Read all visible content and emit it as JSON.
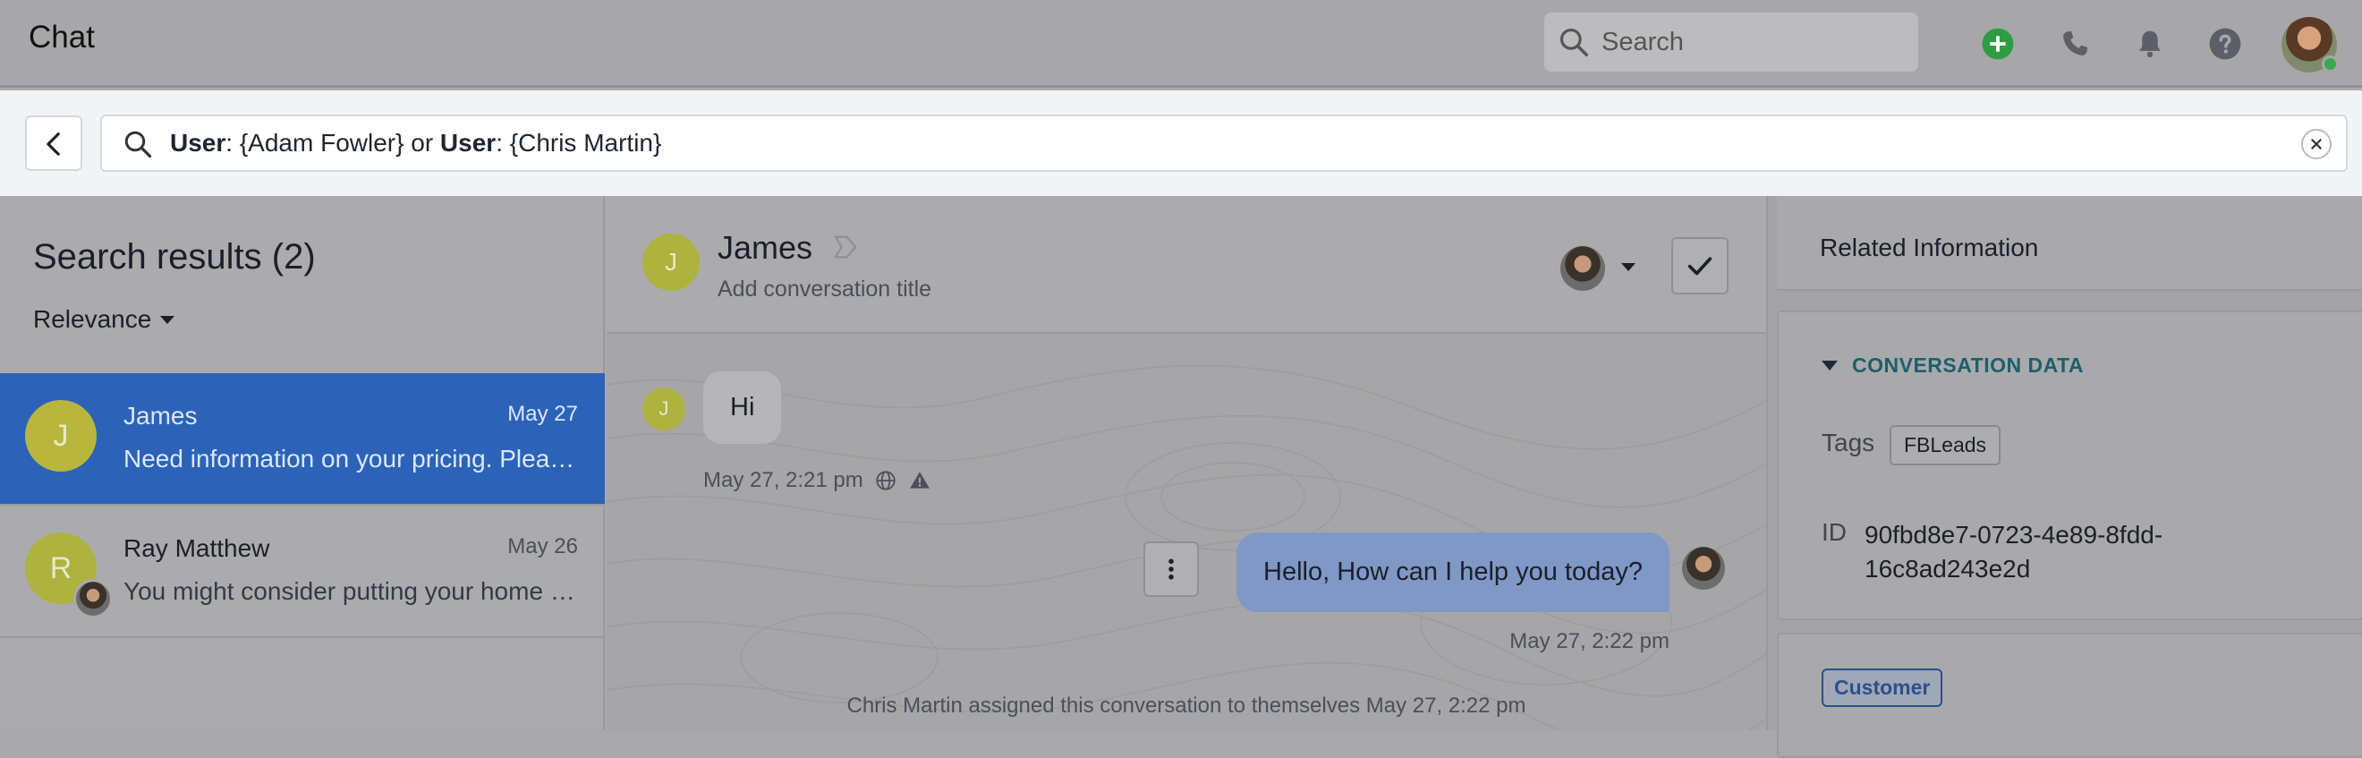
{
  "app": {
    "title": "Chat"
  },
  "header": {
    "search_placeholder": "Search",
    "icons": [
      "add-circle-icon",
      "phone-icon",
      "bell-icon",
      "help-icon"
    ],
    "accent_green": "#3aa84c"
  },
  "filter": {
    "query_part1_bold": "User",
    "query_part1_rest": ": {Adam Fowler} or ",
    "query_part2_bold": "User",
    "query_part2_rest": ": {Chris Martin}"
  },
  "results": {
    "title": "Search results (2)",
    "sort_label": "Relevance",
    "items": [
      {
        "initial": "J",
        "name": "James",
        "date": "May 27",
        "preview": "Need information on your pricing. Please help.",
        "active": true
      },
      {
        "initial": "R",
        "name": "Ray Matthew",
        "date": "May 26",
        "preview": "You might consider putting your home on the market soon.",
        "active": false
      }
    ]
  },
  "conversation": {
    "initial": "J",
    "name": "James",
    "subtitle": "Add conversation title",
    "messages": [
      {
        "direction": "in",
        "author_initial": "J",
        "text": "Hi",
        "time": "May 27, 2:21 pm"
      },
      {
        "direction": "out",
        "text": "Hello, How can I help you today?",
        "time": "May 27, 2:22 pm"
      }
    ],
    "system_note": "Chris Martin assigned this conversation to themselves May 27, 2:22 pm"
  },
  "related": {
    "title": "Related Information",
    "section_title": "CONVERSATION DATA",
    "tags_label": "Tags",
    "tags": [
      "FBLeads"
    ],
    "id_label": "ID",
    "id_value": "90fbd8e7-0723-4e89-8fdd-16c8ad243e2d",
    "badge": "Customer"
  },
  "colors": {
    "selected_row": "#2c63b8",
    "outgoing_bubble": "#7f98c6",
    "section_teal": "#1d5f6b",
    "badge_blue": "#2d4f8c"
  }
}
